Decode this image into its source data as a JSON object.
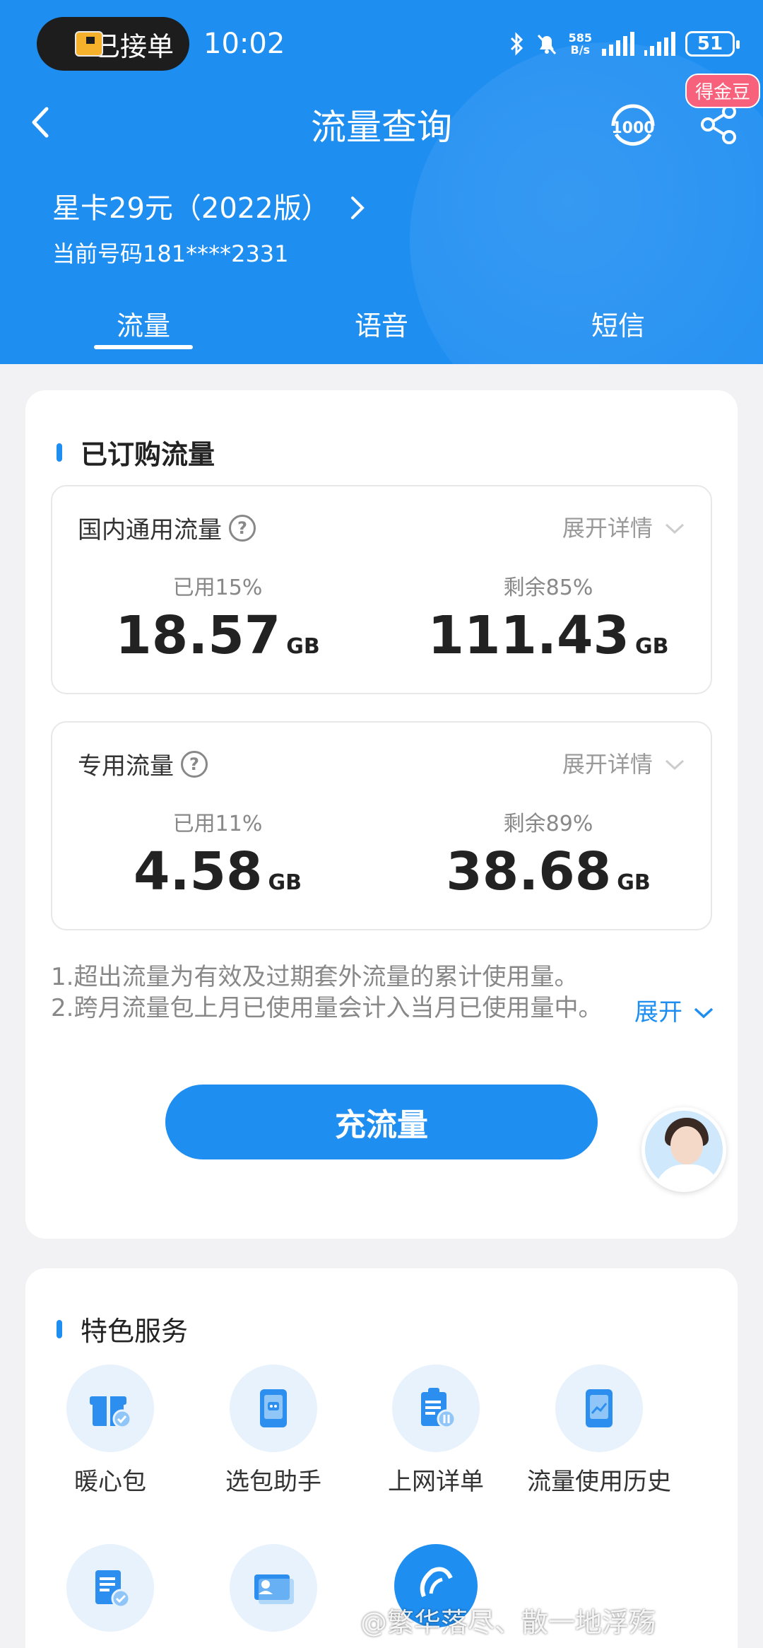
{
  "status_bar": {
    "order_label": "已接单",
    "time": "10:02",
    "net_speed_value": "585",
    "net_speed_unit": "B/s",
    "battery": "51"
  },
  "nav": {
    "title": "流量查询",
    "badge": "得金豆"
  },
  "plan": {
    "name": "星卡29元（2022版）",
    "phone": "当前号码181****2331"
  },
  "tabs": [
    "流量",
    "语音",
    "短信"
  ],
  "subscribed": {
    "title": "已订购流量",
    "domestic": {
      "title": "国内通用流量",
      "expand": "展开详情",
      "used_label": "已用15%",
      "used_value": "18.57",
      "remain_label": "剩余85%",
      "remain_value": "111.43",
      "unit": "GB"
    },
    "special": {
      "title": "专用流量",
      "expand": "展开详情",
      "used_label": "已用11%",
      "used_value": "4.58",
      "remain_label": "剩余89%",
      "remain_value": "38.68",
      "unit": "GB"
    },
    "notes": [
      "1.超出流量为有效及过期套外流量的累计使用量。",
      "2.跨月流量包上月已使用量会计入当月已使用量中。"
    ],
    "expand_link": "展开",
    "cta": "充流量"
  },
  "services": {
    "title": "特色服务",
    "items": [
      "暖心包",
      "选包助手",
      "上网详单",
      "流量使用历史"
    ]
  },
  "watermark": "@繁华落尽、散一地浮殇",
  "colors": {
    "primary": "#1f8ef1",
    "badge": "#f8617b"
  }
}
